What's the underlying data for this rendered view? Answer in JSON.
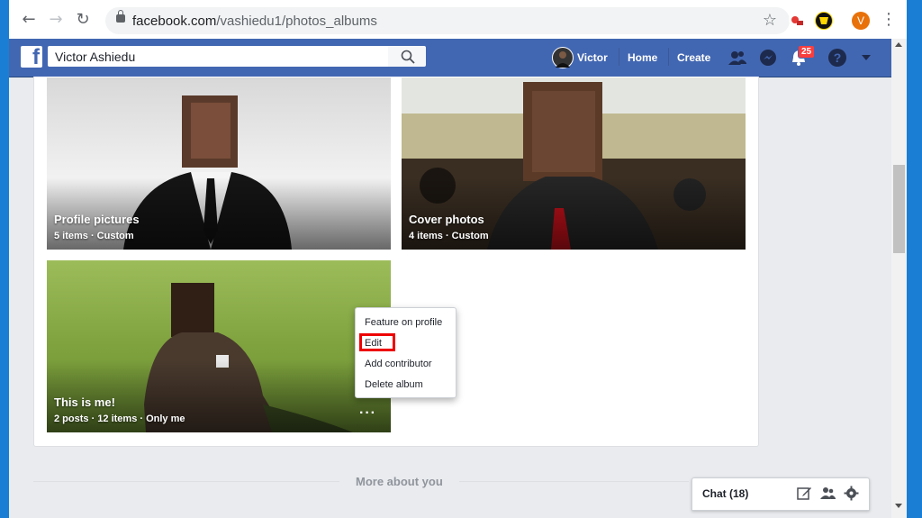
{
  "browser": {
    "url_host": "facebook.com",
    "url_path": "/vashiedu1/photos_albums",
    "profile_initial": "V"
  },
  "fbbar": {
    "search_value": "Victor Ashiedu",
    "user_name": "Victor",
    "home_label": "Home",
    "create_label": "Create",
    "notification_count": "25",
    "brand_color": "#4267b2"
  },
  "albums": [
    {
      "title": "Profile pictures",
      "meta": "5 items · Custom"
    },
    {
      "title": "Cover photos",
      "meta": "4 items · Custom"
    },
    {
      "title": "This is me!",
      "meta": "2 posts · 12 items · Only me"
    }
  ],
  "context_menu": {
    "items": [
      "Feature on profile",
      "Edit",
      "Add contributor",
      "Delete album"
    ],
    "highlight": "Edit"
  },
  "section": {
    "more_about": "More about you"
  },
  "chat": {
    "label": "Chat (18)"
  },
  "icons": [
    "back-icon",
    "forward-icon",
    "reload-icon",
    "lock-icon",
    "star-icon",
    "search-icon",
    "friends-icon",
    "messenger-icon",
    "bell-icon",
    "help-icon",
    "caret-down-icon",
    "compose-icon",
    "group-icon",
    "gear-icon",
    "more-icon"
  ]
}
